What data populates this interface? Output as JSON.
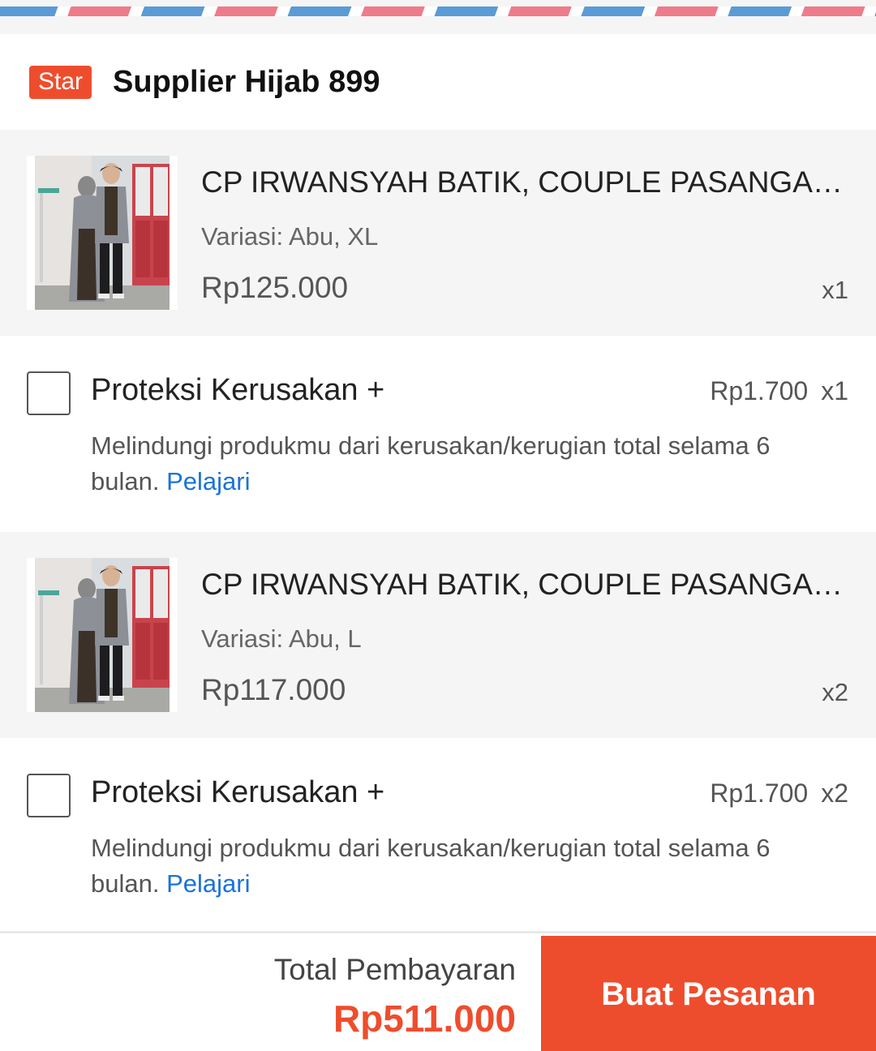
{
  "shop": {
    "badge": "Star",
    "name": "Supplier Hijab 899"
  },
  "items": [
    {
      "title": "CP IRWANSYAH BATIK, COUPLE PASANGAN...",
      "variation": "Variasi: Abu, XL",
      "price": "Rp125.000",
      "qty": "x1",
      "protection": {
        "title": "Proteksi Kerusakan +",
        "price": "Rp1.700",
        "qty": "x1",
        "description": "Melindungi produkmu dari kerusakan/kerugian total selama 6 bulan.",
        "link": "Pelajari",
        "checked": false
      }
    },
    {
      "title": "CP IRWANSYAH BATIK, COUPLE PASANGAN...",
      "variation": "Variasi: Abu, L",
      "price": "Rp117.000",
      "qty": "x2",
      "protection": {
        "title": "Proteksi Kerusakan +",
        "price": "Rp1.700",
        "qty": "x2",
        "description": "Melindungi produkmu dari kerusakan/kerugian total selama 6 bulan.",
        "link": "Pelajari",
        "checked": false
      }
    }
  ],
  "footer": {
    "total_label": "Total Pembayaran",
    "total_value": "Rp511.000",
    "order_button": "Buat Pesanan"
  },
  "colors": {
    "accent": "#ee4d2d",
    "link": "#1a73d9"
  }
}
